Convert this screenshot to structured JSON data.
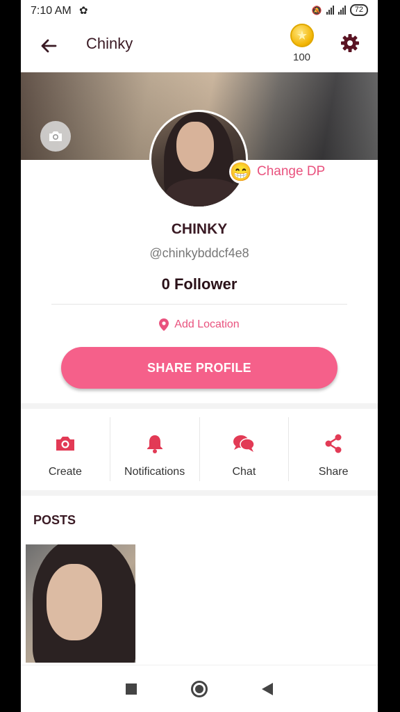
{
  "status_bar": {
    "time": "7:10 AM",
    "battery": "72"
  },
  "app_bar": {
    "title": "Chinky",
    "coins": "100"
  },
  "profile": {
    "change_dp_label": "Change DP",
    "emoji": "😁",
    "name": "CHINKY",
    "handle": "@chinkybddcf4e8",
    "followers": "0 Follower",
    "location_label": "Add Location",
    "share_button": "SHARE PROFILE"
  },
  "actions": [
    {
      "label": "Create",
      "icon": "camera-icon"
    },
    {
      "label": "Notifications",
      "icon": "bell-icon"
    },
    {
      "label": "Chat",
      "icon": "chat-icon"
    },
    {
      "label": "Share",
      "icon": "share-icon"
    }
  ],
  "posts": {
    "heading": "POSTS"
  },
  "colors": {
    "accent": "#f5608a",
    "accent_text": "#e9527e",
    "title": "#3a1a24"
  }
}
